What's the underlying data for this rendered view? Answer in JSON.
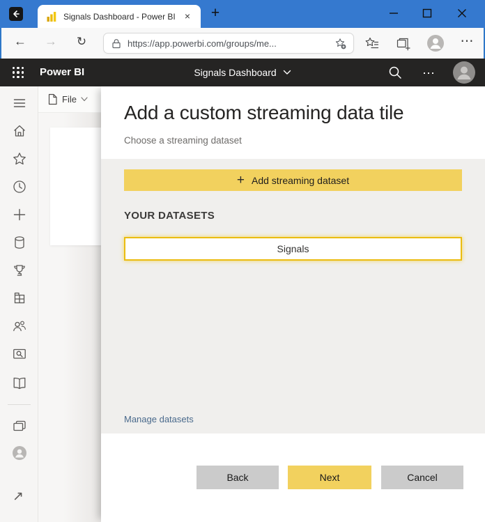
{
  "window_controls": {
    "minimize": "minimize",
    "maximize": "maximize",
    "close": "close"
  },
  "browser": {
    "tab_title": "Signals Dashboard - Power BI",
    "url": "https://app.powerbi.com/groups/me...",
    "glyphs": {
      "tab_close": "×",
      "new_tab": "+",
      "back": "←",
      "forward": "→",
      "refresh": "↻",
      "more": "⋯"
    }
  },
  "pbi": {
    "brand": "Power BI",
    "doc_title": "Signals Dashboard",
    "glyphs": {
      "more": "⋯"
    }
  },
  "filebar": {
    "label": "File"
  },
  "sidebar": {
    "items": [
      "menu",
      "home",
      "favorites",
      "recent",
      "create",
      "datasets",
      "goals",
      "workspaces",
      "shared-with-me",
      "explore",
      "learn",
      "browse",
      "my-workspace",
      "open-in-new"
    ],
    "glyphs": {
      "external": "↗"
    }
  },
  "dialog": {
    "title": "Add a custom streaming data tile",
    "subtitle": "Choose a streaming dataset",
    "add_button_label": "Add streaming dataset",
    "plus_glyph": "+",
    "datasets_heading": "YOUR DATASETS",
    "datasets": [
      {
        "name": "Signals",
        "selected": true
      }
    ],
    "manage_link": "Manage datasets",
    "buttons": {
      "back": "Back",
      "next": "Next",
      "cancel": "Cancel"
    }
  },
  "colors": {
    "titlebar_blue": "#3579CF",
    "pbi_header_black": "#252423",
    "accent_yellow": "#F2D15E",
    "dataset_selected_border": "#EBBC10",
    "link_blue": "#4A6A8C",
    "neutral_button_gray": "#CBCBCB"
  }
}
